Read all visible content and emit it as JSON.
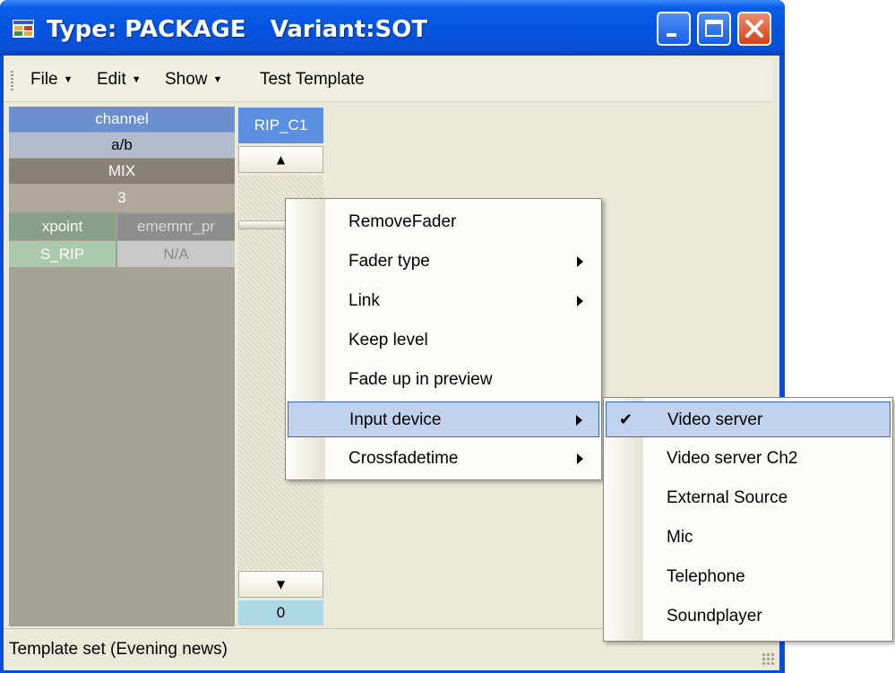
{
  "window": {
    "title": "Type: PACKAGE   Variant:SOT",
    "buttons": [
      "minimize",
      "maximize",
      "close"
    ]
  },
  "menubar": {
    "items": [
      {
        "label": "File",
        "has_dropdown": true
      },
      {
        "label": "Edit",
        "has_dropdown": true
      },
      {
        "label": "Show",
        "has_dropdown": true
      },
      {
        "label": "Test Template",
        "has_dropdown": false
      }
    ]
  },
  "channel_panel": {
    "header": "channel",
    "ab": "a/b",
    "mix": "MIX",
    "number": "3",
    "col1_header": "xpoint",
    "col2_header": "ememnr_pr",
    "col1_value": "S_RIP",
    "col2_value": "N/A"
  },
  "fader_strip": {
    "label": "RIP_C1",
    "up_icon": "triangle-up-icon",
    "down_icon": "triangle-down-icon",
    "value": "0"
  },
  "context_menu": {
    "items": [
      {
        "label": "RemoveFader",
        "submenu": false,
        "highlighted": false
      },
      {
        "label": "Fader type",
        "submenu": true,
        "highlighted": false
      },
      {
        "label": "Link",
        "submenu": true,
        "highlighted": false
      },
      {
        "label": "Keep level",
        "submenu": false,
        "highlighted": false
      },
      {
        "label": "Fade up in preview",
        "submenu": false,
        "highlighted": false
      },
      {
        "label": "Input device",
        "submenu": true,
        "highlighted": true
      },
      {
        "label": "Crossfadetime",
        "submenu": true,
        "highlighted": false
      }
    ]
  },
  "input_device_submenu": {
    "items": [
      {
        "label": "Video server",
        "checked": true,
        "highlighted": true
      },
      {
        "label": "Video server Ch2",
        "checked": false,
        "highlighted": false
      },
      {
        "label": "External Source",
        "checked": false,
        "highlighted": false
      },
      {
        "label": "Mic",
        "checked": false,
        "highlighted": false
      },
      {
        "label": "Telephone",
        "checked": false,
        "highlighted": false
      },
      {
        "label": "Soundplayer",
        "checked": false,
        "highlighted": false
      }
    ]
  },
  "statusbar": {
    "text": "Template set (Evening news)"
  },
  "colors": {
    "titlebar": "#0554e0",
    "highlight": "#c1d2ee",
    "highlight_border": "#316ac5",
    "channel_header": "#6c8fcf",
    "xpoint": "#96af96",
    "value_box": "#acd8e6"
  }
}
